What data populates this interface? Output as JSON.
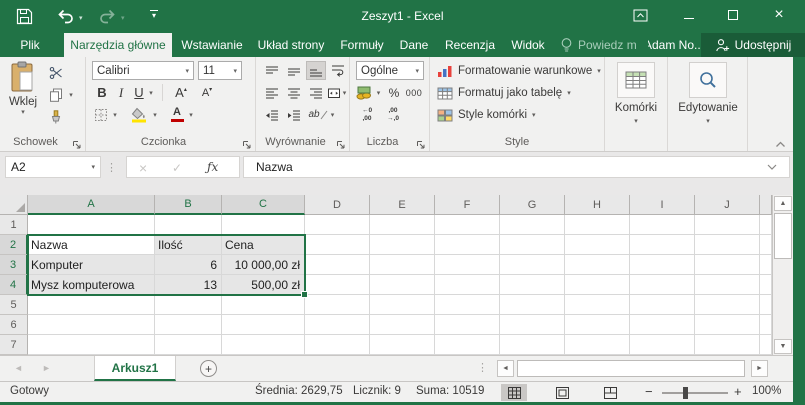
{
  "window": {
    "title": "Zeszyt1 - Excel"
  },
  "colors": {
    "accent": "#217346",
    "share_button_bg": "#1A5C38",
    "selection_fill": "#E6E6E6",
    "fill_color_swatch": "#FFE400",
    "font_color_swatch": "#C00000"
  },
  "glyphs": {
    "dropdown": "▾",
    "tri_up": "▴",
    "tri_down": "▾",
    "left": "◄",
    "right": "►",
    "up": "▲",
    "down": "▼",
    "cancel": "×",
    "check": "✓",
    "fx": "ƒx",
    "dots": "⋮",
    "plus": "+",
    "minus": "−",
    "bold": "B",
    "italic": "I",
    "underline": "U",
    "grow_font": "A",
    "shrink_font": "A",
    "font_color_letter": "A",
    "percent": "%",
    "thousands": "000",
    "inc_dec_top": "←0",
    "inc_dec_bot": ",00",
    "dec_dec_top": ",00",
    "dec_dec_bot": "→,0",
    "orientation": "ab"
  },
  "tabs": {
    "file": "Plik",
    "main": [
      "Narzędzia główne",
      "Wstawianie",
      "Układ strony",
      "Formuły",
      "Dane",
      "Recenzja",
      "Widok"
    ],
    "active": "Narzędzia główne",
    "tell_me": "Powiedz m",
    "account": "Adam No...",
    "share": "Udostępnij"
  },
  "ribbon": {
    "clipboard": {
      "label": "Schowek",
      "paste": "Wklej"
    },
    "font": {
      "label": "Czcionka",
      "name": "Calibri",
      "size": "11"
    },
    "alignment": {
      "label": "Wyrównanie"
    },
    "number": {
      "label": "Liczba",
      "format": "Ogólne"
    },
    "styles": {
      "label": "Style",
      "conditional": "Formatowanie warunkowe",
      "as_table": "Formatuj jako tabelę",
      "cell_styles": "Style komórki"
    },
    "cells": {
      "label": "Komórki"
    },
    "editing": {
      "label": "Edytowanie"
    }
  },
  "formula_bar": {
    "name_box": "A2",
    "value": "Nazwa"
  },
  "sheet": {
    "columns": [
      "A",
      "B",
      "C",
      "D",
      "E",
      "F",
      "G",
      "H",
      "I",
      "J"
    ],
    "rows": [
      "1",
      "2",
      "3",
      "4",
      "5",
      "6",
      "7"
    ],
    "selected_columns": [
      "A",
      "B",
      "C"
    ],
    "selected_rows": [
      "2",
      "3",
      "4"
    ],
    "active_cell": "A2",
    "selection": "A2:C4",
    "cells": {
      "A2": "Nazwa",
      "B2": "Ilość",
      "C2": "Cena",
      "A3": "Komputer",
      "B3": "6",
      "C3": "10 000,00 zł",
      "A4": "Mysz komputerowa",
      "B4": "13",
      "C4": "500,00 zł"
    }
  },
  "sheet_tabs": {
    "active": "Arkusz1"
  },
  "status_bar": {
    "mode": "Gotowy",
    "average": "Średnia: 2629,75",
    "count": "Licznik: 9",
    "sum": "Suma: 10519",
    "zoom": "100%"
  }
}
